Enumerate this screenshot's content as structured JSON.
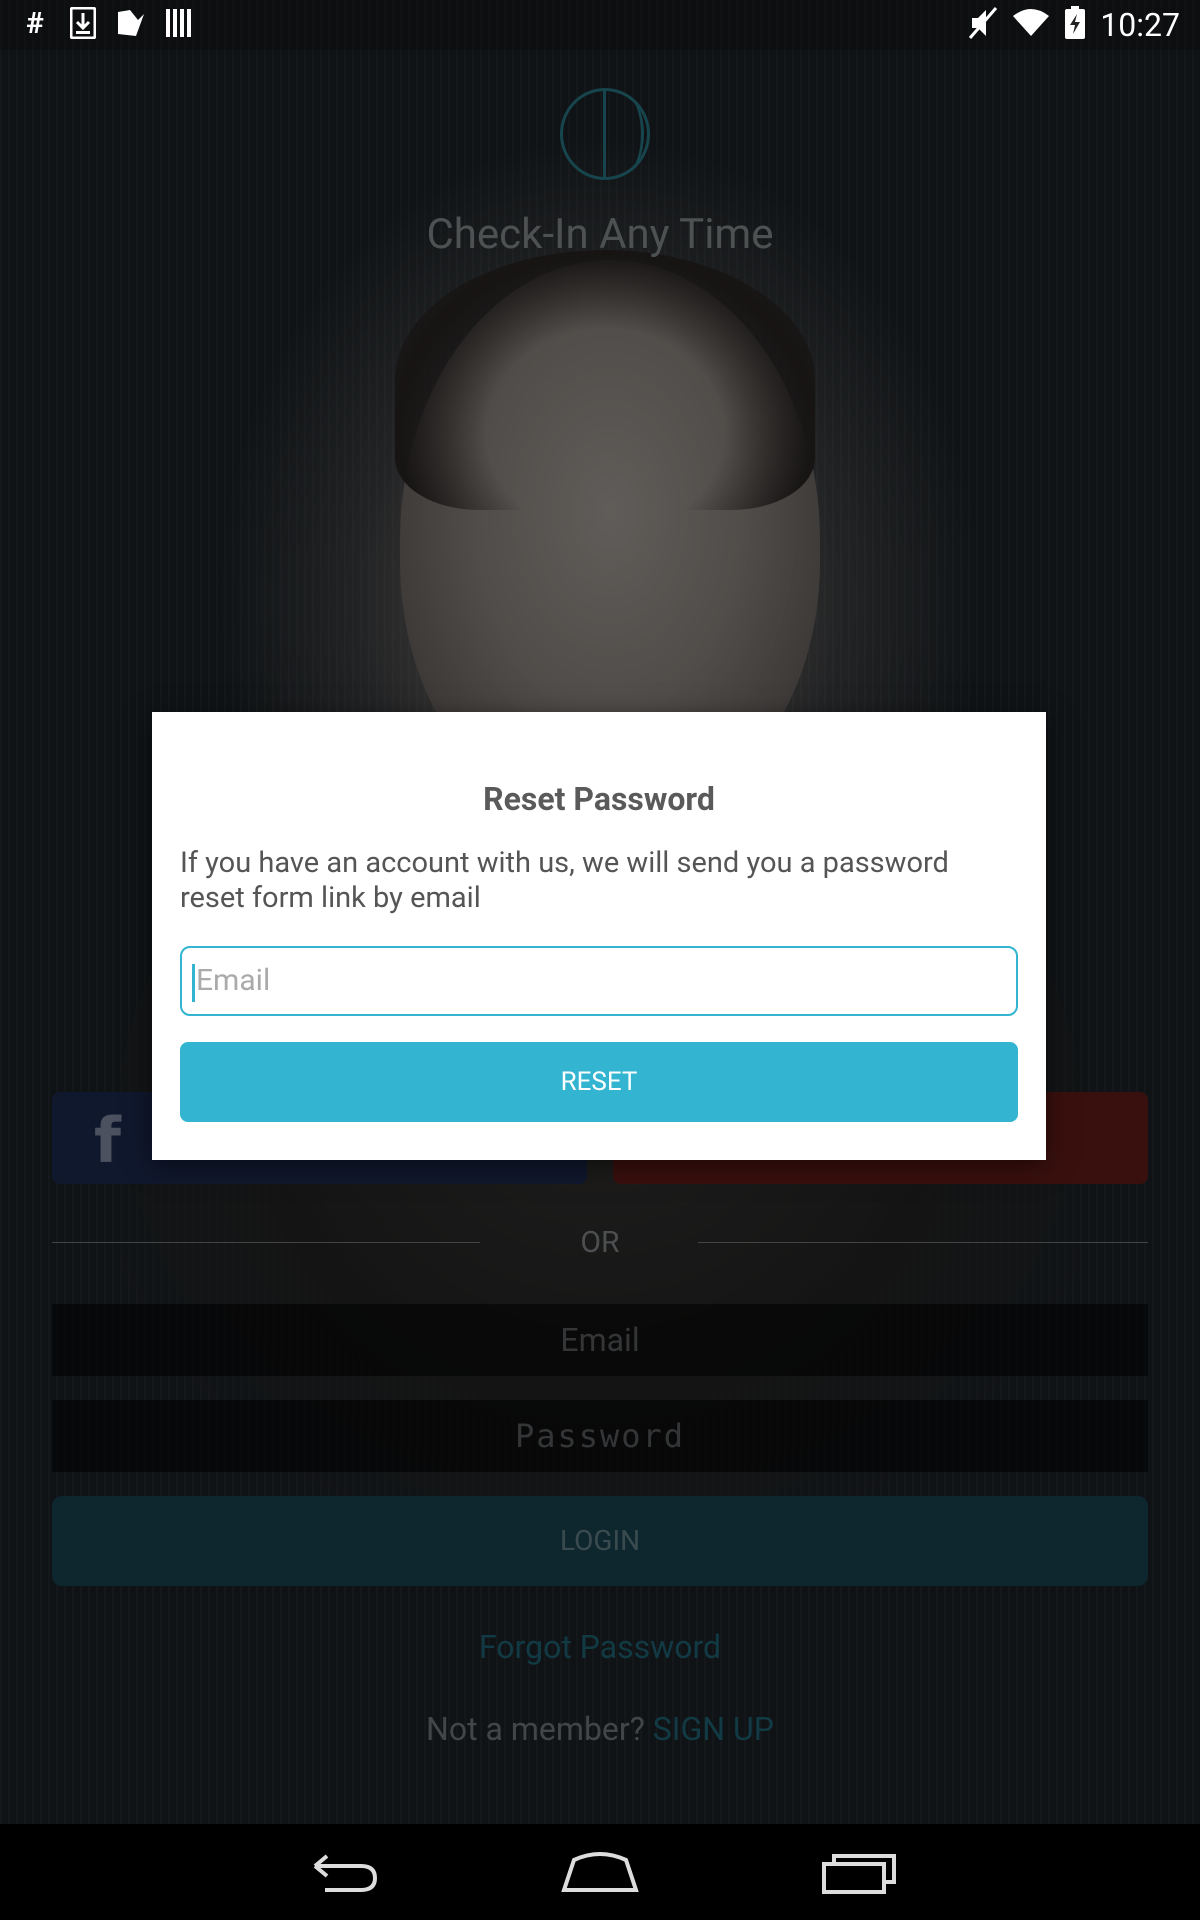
{
  "status_bar": {
    "left_icons": [
      "hash-icon",
      "download-icon",
      "play-store-icon",
      "barcode-icon"
    ],
    "right_icons": [
      "mute-icon",
      "wifi-icon",
      "battery-charging-icon"
    ],
    "time": "10:27"
  },
  "login": {
    "tagline": "Check-In Any Time",
    "facebook_glyph": "f",
    "or_text": "OR",
    "email_placeholder": "Email",
    "password_placeholder": "Password",
    "login_label": "LOGIN",
    "forgot_label": "Forgot Password",
    "member_text": "Not a member?",
    "signup_label": "SIGN UP"
  },
  "dialog": {
    "title": "Reset Password",
    "message": "If you have an account with us, we will send you a password reset form link by email",
    "email_placeholder": "Email",
    "reset_label": "RESET"
  },
  "navbar": {
    "buttons": [
      "back-icon",
      "home-icon",
      "recent-apps-icon"
    ]
  },
  "colors": {
    "accent": "#33b5d1",
    "facebook": "#1e2d55",
    "google": "#6a1e1a"
  }
}
